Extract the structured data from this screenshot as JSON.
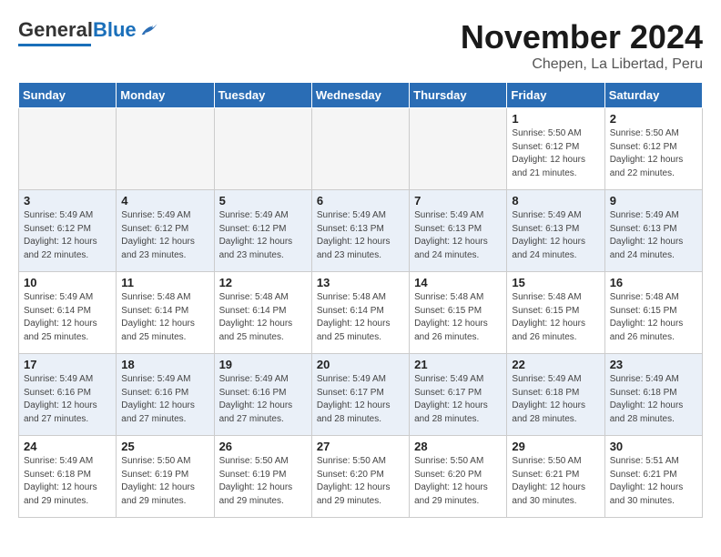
{
  "header": {
    "logo_general": "General",
    "logo_blue": "Blue",
    "month_title": "November 2024",
    "location": "Chepen, La Libertad, Peru"
  },
  "weekdays": [
    "Sunday",
    "Monday",
    "Tuesday",
    "Wednesday",
    "Thursday",
    "Friday",
    "Saturday"
  ],
  "weeks": [
    [
      {
        "day": "",
        "info": ""
      },
      {
        "day": "",
        "info": ""
      },
      {
        "day": "",
        "info": ""
      },
      {
        "day": "",
        "info": ""
      },
      {
        "day": "",
        "info": ""
      },
      {
        "day": "1",
        "info": "Sunrise: 5:50 AM\nSunset: 6:12 PM\nDaylight: 12 hours\nand 21 minutes."
      },
      {
        "day": "2",
        "info": "Sunrise: 5:50 AM\nSunset: 6:12 PM\nDaylight: 12 hours\nand 22 minutes."
      }
    ],
    [
      {
        "day": "3",
        "info": "Sunrise: 5:49 AM\nSunset: 6:12 PM\nDaylight: 12 hours\nand 22 minutes."
      },
      {
        "day": "4",
        "info": "Sunrise: 5:49 AM\nSunset: 6:12 PM\nDaylight: 12 hours\nand 23 minutes."
      },
      {
        "day": "5",
        "info": "Sunrise: 5:49 AM\nSunset: 6:12 PM\nDaylight: 12 hours\nand 23 minutes."
      },
      {
        "day": "6",
        "info": "Sunrise: 5:49 AM\nSunset: 6:13 PM\nDaylight: 12 hours\nand 23 minutes."
      },
      {
        "day": "7",
        "info": "Sunrise: 5:49 AM\nSunset: 6:13 PM\nDaylight: 12 hours\nand 24 minutes."
      },
      {
        "day": "8",
        "info": "Sunrise: 5:49 AM\nSunset: 6:13 PM\nDaylight: 12 hours\nand 24 minutes."
      },
      {
        "day": "9",
        "info": "Sunrise: 5:49 AM\nSunset: 6:13 PM\nDaylight: 12 hours\nand 24 minutes."
      }
    ],
    [
      {
        "day": "10",
        "info": "Sunrise: 5:49 AM\nSunset: 6:14 PM\nDaylight: 12 hours\nand 25 minutes."
      },
      {
        "day": "11",
        "info": "Sunrise: 5:48 AM\nSunset: 6:14 PM\nDaylight: 12 hours\nand 25 minutes."
      },
      {
        "day": "12",
        "info": "Sunrise: 5:48 AM\nSunset: 6:14 PM\nDaylight: 12 hours\nand 25 minutes."
      },
      {
        "day": "13",
        "info": "Sunrise: 5:48 AM\nSunset: 6:14 PM\nDaylight: 12 hours\nand 25 minutes."
      },
      {
        "day": "14",
        "info": "Sunrise: 5:48 AM\nSunset: 6:15 PM\nDaylight: 12 hours\nand 26 minutes."
      },
      {
        "day": "15",
        "info": "Sunrise: 5:48 AM\nSunset: 6:15 PM\nDaylight: 12 hours\nand 26 minutes."
      },
      {
        "day": "16",
        "info": "Sunrise: 5:48 AM\nSunset: 6:15 PM\nDaylight: 12 hours\nand 26 minutes."
      }
    ],
    [
      {
        "day": "17",
        "info": "Sunrise: 5:49 AM\nSunset: 6:16 PM\nDaylight: 12 hours\nand 27 minutes."
      },
      {
        "day": "18",
        "info": "Sunrise: 5:49 AM\nSunset: 6:16 PM\nDaylight: 12 hours\nand 27 minutes."
      },
      {
        "day": "19",
        "info": "Sunrise: 5:49 AM\nSunset: 6:16 PM\nDaylight: 12 hours\nand 27 minutes."
      },
      {
        "day": "20",
        "info": "Sunrise: 5:49 AM\nSunset: 6:17 PM\nDaylight: 12 hours\nand 28 minutes."
      },
      {
        "day": "21",
        "info": "Sunrise: 5:49 AM\nSunset: 6:17 PM\nDaylight: 12 hours\nand 28 minutes."
      },
      {
        "day": "22",
        "info": "Sunrise: 5:49 AM\nSunset: 6:18 PM\nDaylight: 12 hours\nand 28 minutes."
      },
      {
        "day": "23",
        "info": "Sunrise: 5:49 AM\nSunset: 6:18 PM\nDaylight: 12 hours\nand 28 minutes."
      }
    ],
    [
      {
        "day": "24",
        "info": "Sunrise: 5:49 AM\nSunset: 6:18 PM\nDaylight: 12 hours\nand 29 minutes."
      },
      {
        "day": "25",
        "info": "Sunrise: 5:50 AM\nSunset: 6:19 PM\nDaylight: 12 hours\nand 29 minutes."
      },
      {
        "day": "26",
        "info": "Sunrise: 5:50 AM\nSunset: 6:19 PM\nDaylight: 12 hours\nand 29 minutes."
      },
      {
        "day": "27",
        "info": "Sunrise: 5:50 AM\nSunset: 6:20 PM\nDaylight: 12 hours\nand 29 minutes."
      },
      {
        "day": "28",
        "info": "Sunrise: 5:50 AM\nSunset: 6:20 PM\nDaylight: 12 hours\nand 29 minutes."
      },
      {
        "day": "29",
        "info": "Sunrise: 5:50 AM\nSunset: 6:21 PM\nDaylight: 12 hours\nand 30 minutes."
      },
      {
        "day": "30",
        "info": "Sunrise: 5:51 AM\nSunset: 6:21 PM\nDaylight: 12 hours\nand 30 minutes."
      }
    ]
  ]
}
